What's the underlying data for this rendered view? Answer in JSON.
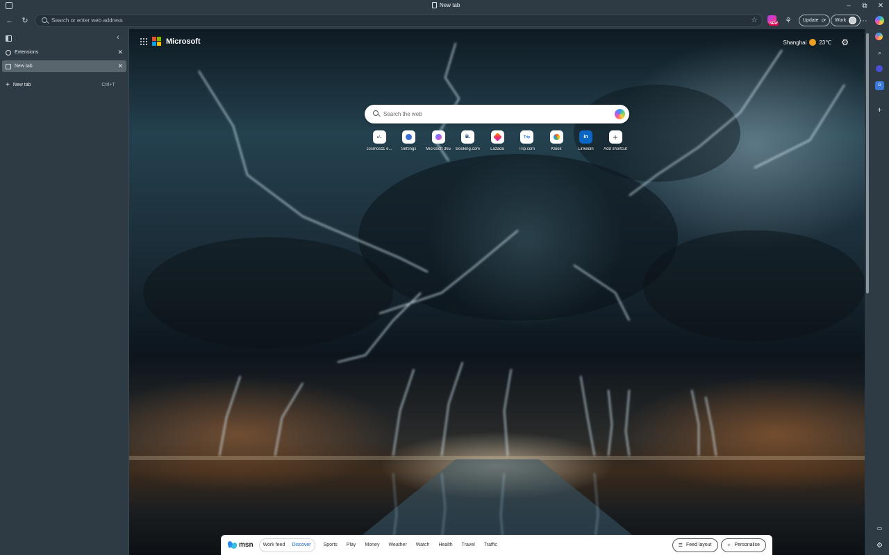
{
  "window": {
    "title": "New tab",
    "controls": {
      "minimize": "–",
      "restore": "⧉",
      "close": "✕"
    }
  },
  "toolbar": {
    "back_icon": "←",
    "refresh_icon": "↻",
    "address_placeholder": "Search or enter web address",
    "favorite_icon": "☆",
    "new_badge": "NEW",
    "update_label": "Update",
    "profile_label": "Work",
    "more_icon": "···"
  },
  "sidebar": {
    "collapse_icon": "‹",
    "tabs": [
      {
        "label": "Extensions",
        "active": false,
        "close": "✕"
      },
      {
        "label": "New tab",
        "active": true,
        "close": "✕"
      }
    ],
    "new_tab": {
      "label": "New tab",
      "shortcut": "Ctrl+T",
      "icon": "+"
    }
  },
  "page": {
    "brand": "Microsoft",
    "weather": {
      "city": "Shanghai",
      "temp": "23℃",
      "icon": "sun-icon"
    },
    "settings_icon": "⚙",
    "search_placeholder": "Search the web",
    "shortcuts": [
      {
        "label": "cosmos11 e...",
        "icon_text": "●/..",
        "icon_color": "#555555"
      },
      {
        "label": "Settings",
        "icon_text": "",
        "icon_color": "#3a6fd8"
      },
      {
        "label": "Microsoft 365",
        "icon_text": "",
        "icon_color": "#6b4fd8"
      },
      {
        "label": "Booking.com",
        "icon_text": "B.",
        "icon_color": "#003580"
      },
      {
        "label": "Lazada",
        "icon_text": "",
        "icon_color": "#f0345a"
      },
      {
        "label": "Trip.com",
        "icon_text": "Trip",
        "icon_color": "#287dfa"
      },
      {
        "label": "Klook",
        "icon_text": "",
        "icon_color": "#ff5722"
      },
      {
        "label": "Linkedin",
        "icon_text": "in",
        "icon_color": "#0a66c2"
      },
      {
        "label": "Add shortcut",
        "icon_text": "+",
        "icon_color": "#444444"
      }
    ]
  },
  "msn": {
    "logo": "msn",
    "feed_tabs": {
      "work": "Work feed",
      "discover": "Discover"
    },
    "nav": [
      "Sports",
      "Play",
      "Money",
      "Weather",
      "Watch",
      "Health",
      "Travel",
      "Traffic"
    ],
    "feed_layout": "Feed layout",
    "personalise": "Personalise"
  },
  "rightbar": {
    "icons": [
      "copilot-icon",
      "copilot-secondary-icon",
      "search-icon",
      "m365-icon",
      "translate-icon",
      "add-icon"
    ]
  },
  "colors": {
    "accent_blue": "#0a66c2",
    "chrome_bg": "#2f3b44",
    "active_tab": "#59656d"
  }
}
